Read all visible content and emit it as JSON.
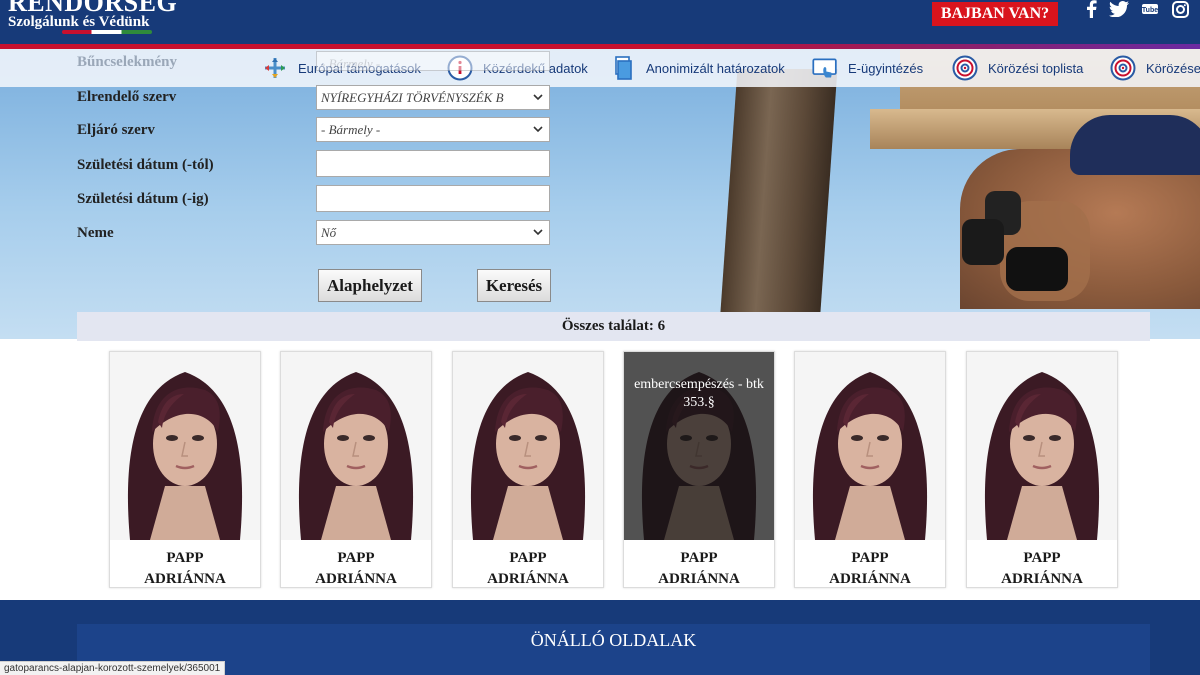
{
  "header": {
    "logo_title": "RENDŐRSÉG",
    "logo_subtitle": "Szolgálunk és Védünk",
    "alert_button": "BAJBAN VAN?",
    "social_icons": [
      "facebook-icon",
      "twitter-icon",
      "youtube-icon",
      "instagram-icon"
    ],
    "youtube_text": "You Tube"
  },
  "nav": {
    "items": [
      {
        "label": "Európai támogatások",
        "icon": "cross-arrows-icon"
      },
      {
        "label": "Közérdekű adatok",
        "icon": "info-icon"
      },
      {
        "label": "Anonimizált határozatok",
        "icon": "documents-icon"
      },
      {
        "label": "E-ügyintézés",
        "icon": "touch-screen-icon"
      },
      {
        "label": "Körözési toplista",
        "icon": "target-icon"
      },
      {
        "label": "Körözése",
        "icon": "target-icon"
      }
    ]
  },
  "form": {
    "crime_label": "Bűncselekmény",
    "crime_value": "- Bármely -",
    "ordering_label": "Elrendelő szerv",
    "ordering_value": "NYÍREGYHÁZI TÖRVÉNYSZÉK B",
    "proceeding_label": "Eljáró szerv",
    "proceeding_value": "- Bármely -",
    "birth_from_label": "Születési dátum (-tól)",
    "birth_from_value": "",
    "birth_to_label": "Születési dátum (-ig)",
    "birth_to_value": "",
    "gender_label": "Neme",
    "gender_value": "Nő",
    "reset_button": "Alaphelyzet",
    "search_button": "Keresés"
  },
  "results": {
    "count_text": "Összes találat: 6",
    "cards": [
      {
        "name_line1": "PAPP",
        "name_line2": "ADRIÁNNA",
        "hover_text": ""
      },
      {
        "name_line1": "PAPP",
        "name_line2": "ADRIÁNNA",
        "hover_text": ""
      },
      {
        "name_line1": "PAPP",
        "name_line2": "ADRIÁNNA",
        "hover_text": ""
      },
      {
        "name_line1": "PAPP",
        "name_line2": "ADRIÁNNA",
        "hover_text": "embercsempészés - btk 353.§"
      },
      {
        "name_line1": "PAPP",
        "name_line2": "ADRIÁNNA",
        "hover_text": ""
      },
      {
        "name_line1": "PAPP",
        "name_line2": "ADRIÁNNA",
        "hover_text": ""
      }
    ]
  },
  "footer": {
    "title": "ÖNÁLLÓ OLDALAK"
  },
  "status_bar": {
    "url": "gatoparancs-alapjan-korozott-szemelyek/365001"
  },
  "colors": {
    "header_blue": "#173a79",
    "alert_red": "#d9141d",
    "results_bar": "#e3e6f1"
  }
}
